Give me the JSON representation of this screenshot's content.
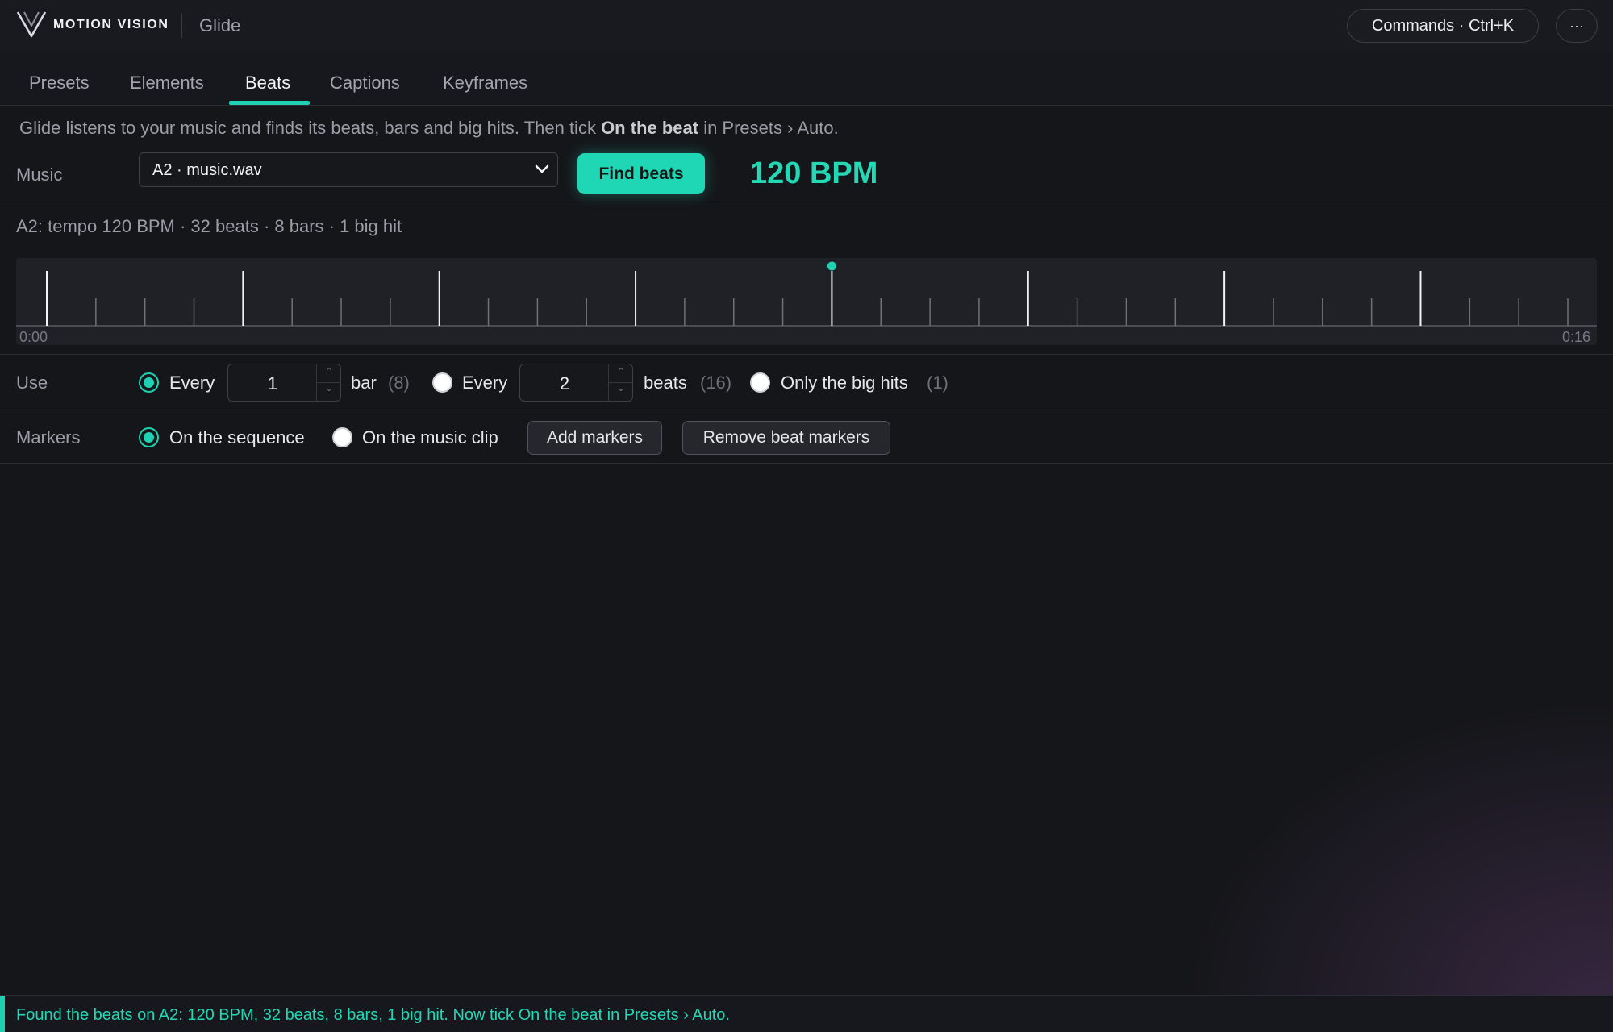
{
  "header": {
    "brand": "MOTION VISION",
    "app_name": "Glide",
    "commands_label": "Commands · Ctrl+K",
    "more_label": "···"
  },
  "tabs": [
    {
      "label": "Presets"
    },
    {
      "label": "Elements"
    },
    {
      "label": "Beats"
    },
    {
      "label": "Captions"
    },
    {
      "label": "Keyframes"
    }
  ],
  "active_tab": "Beats",
  "intro": {
    "before": "Glide listens to your music and finds its beats, bars and big hits. Then tick ",
    "emphasis": "On the beat",
    "after": " in Presets › Auto."
  },
  "music": {
    "label": "Music",
    "selected": "A2 · music.wav",
    "find_button": "Find beats",
    "bpm": "120 BPM"
  },
  "summary": "A2: tempo 120 BPM · 32 beats · 8 bars · 1 big hit",
  "timeline": {
    "start_label": "0:00",
    "end_label": "0:16",
    "duration_seconds": 16,
    "beats": 32,
    "beats_per_bar": 4,
    "big_hit_time_seconds": 8
  },
  "use": {
    "label": "Use",
    "option_bar": {
      "prefix": "Every",
      "value": "1",
      "unit": "bar",
      "count": "(8)",
      "selected": true
    },
    "option_beats": {
      "prefix": "Every",
      "value": "2",
      "unit": "beats",
      "count": "(16)",
      "selected": false
    },
    "option_hits": {
      "label": "Only the big hits",
      "count": "(1)",
      "selected": false
    }
  },
  "markers": {
    "label": "Markers",
    "option_sequence": {
      "label": "On the sequence",
      "selected": true
    },
    "option_clip": {
      "label": "On the music clip",
      "selected": false
    },
    "add_button": "Add markers",
    "remove_button": "Remove beat markers"
  },
  "status": "Found the beats on A2: 120 BPM, 32 beats, 8 bars, 1 big hit. Now tick On the beat in Presets › Auto.",
  "colors": {
    "accent": "#1fd1b2",
    "background": "#15161a"
  }
}
